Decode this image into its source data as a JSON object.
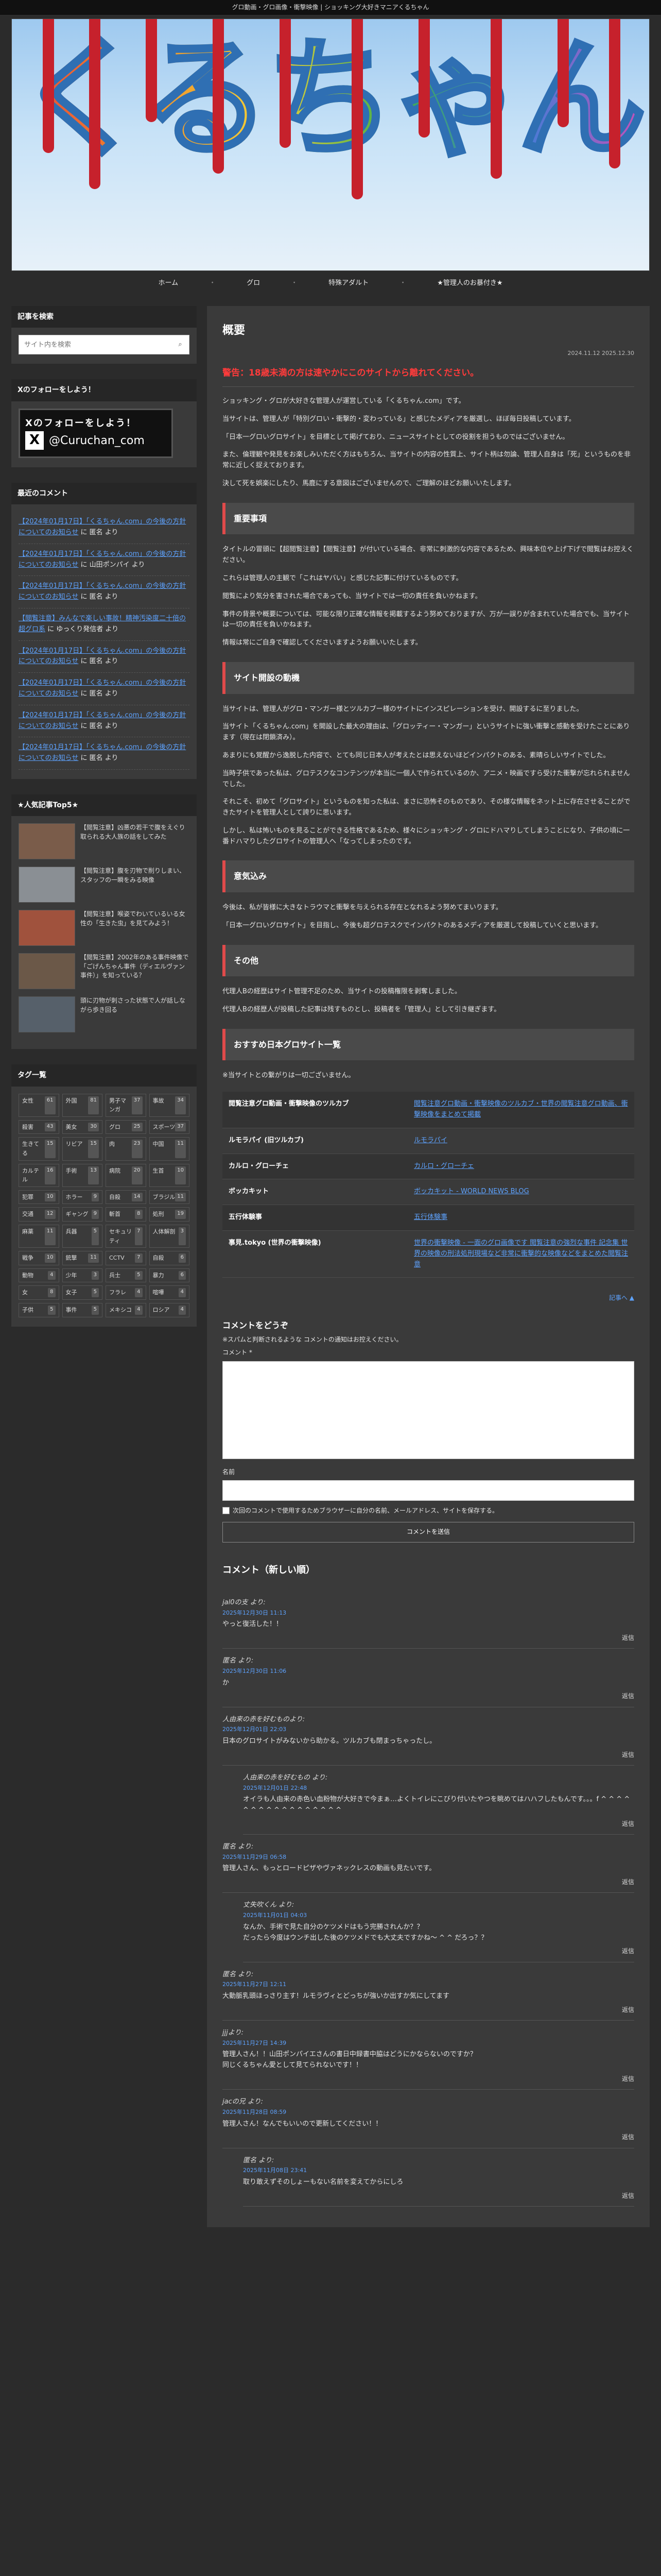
{
  "topbar": "グロ動画・グロ画像・衝撃映像 | ショッキング大好きマニアくるちゃん",
  "banner": {
    "logo_text": "くるちゃん"
  },
  "nav": [
    "ホーム",
    "グロ",
    "特殊アダルト",
    "★管理人のお暴付き★"
  ],
  "sidebar": {
    "search_title": "記事を検索",
    "search_placeholder": "サイト内を検索",
    "follow_title": "Xのフォローをしよう！",
    "x_badge": {
      "line1": "Xのフォローをしよう！",
      "handle": "@Curuchan_com"
    },
    "recent_title": "最近のコメント",
    "recent_comments": [
      {
        "link": "【2024年01月17日】「くるちゃん.com」の今後の方針についてのお知らせ",
        "by": "に 匿名 より"
      },
      {
        "link": "【2024年01月17日】「くるちゃん.com」の今後の方針についてのお知らせ",
        "by": "に 山田ポンパイ より"
      },
      {
        "link": "【2024年01月17日】「くるちゃん.com」の今後の方針についてのお知らせ",
        "by": "に 匿名 より"
      },
      {
        "link": "【閲覧注意】みんなで楽しい事故！精神汚染度二十倍の超グロ系",
        "by": "に ゆっくり発信者 より"
      },
      {
        "link": "【2024年01月17日】「くるちゃん.com」の今後の方針についてのお知らせ",
        "by": "に 匿名 より"
      },
      {
        "link": "【2024年01月17日】「くるちゃん.com」の今後の方針についてのお知らせ",
        "by": "に 匿名 より"
      },
      {
        "link": "【2024年01月17日】「くるちゃん.com」の今後の方針についてのお知らせ",
        "by": "に 匿名 より"
      },
      {
        "link": "【2024年01月17日】「くるちゃん.com」の今後の方針についてのお知らせ",
        "by": "に 匿名 より"
      }
    ],
    "popular_title": "★人気記事Top5★",
    "popular": [
      {
        "text": "【閲覧注意】凶悪の若干で腹をえぐり取られる大人族の話をしてみた",
        "color": "#7a5c4a"
      },
      {
        "text": "【閲覧注意】腹を刃物で削りしまい、スタッフの一瞬をみる映像",
        "color": "#8a8f94"
      },
      {
        "text": "【閲覧注意】喉姿でわいているいる女性の「生きた虫」を見てみよう！",
        "color": "#a0523d"
      },
      {
        "text": "【閲覧注意】2002年のある事件映像で「ごげんちゃん事件（ディエルヴァン事件）」を知っている？",
        "color": "#6b5848"
      },
      {
        "text": "頭に刃物が刺さった状態で人が話しながら歩き回る",
        "color": "#56606a"
      }
    ],
    "tags_title": "タグ一覧",
    "tags": [
      [
        "女性",
        "61"
      ],
      [
        "外国",
        "81"
      ],
      [
        "男子マンガ",
        "37"
      ],
      [
        "事故",
        "34"
      ],
      [
        "殺害",
        "43"
      ],
      [
        "美女",
        "30"
      ],
      [
        "グロ",
        "25"
      ],
      [
        "スポーツ",
        "37"
      ],
      [
        "生きてる",
        "15"
      ],
      [
        "リビア",
        "15"
      ],
      [
        "肉",
        "23"
      ],
      [
        "中国",
        "11"
      ],
      [
        "カルテル",
        "16"
      ],
      [
        "手術",
        "13"
      ],
      [
        "病院",
        "20"
      ],
      [
        "生首",
        "10"
      ],
      [
        "犯罪",
        "10"
      ],
      [
        "ホラー",
        "9"
      ],
      [
        "自殺",
        "14"
      ],
      [
        "ブラジル",
        "11"
      ],
      [
        "交通",
        "12"
      ],
      [
        "ギャング",
        "9"
      ],
      [
        "斬首",
        "8"
      ],
      [
        "処刑",
        "19"
      ],
      [
        "麻薬",
        "11"
      ],
      [
        "兵器",
        "5"
      ],
      [
        "セキュリティ",
        "7"
      ],
      [
        "人体解剖",
        "3"
      ],
      [
        "戦争",
        "10"
      ],
      [
        "銃撃",
        "11"
      ],
      [
        "CCTV",
        "7"
      ],
      [
        "自殺",
        "6"
      ],
      [
        "動物",
        "4"
      ],
      [
        "少年",
        "3"
      ],
      [
        "兵士",
        "5"
      ],
      [
        "暴力",
        "6"
      ],
      [
        "女",
        "8"
      ],
      [
        "女子",
        "5"
      ],
      [
        "フラレ",
        "4"
      ],
      [
        "喧嘩",
        "4"
      ],
      [
        "子供",
        "5"
      ],
      [
        "事件",
        "5"
      ],
      [
        "メキシコ",
        "4"
      ],
      [
        "ロシア",
        "4"
      ]
    ]
  },
  "main": {
    "title": "概要",
    "date": "2024.11.12  2025.12.30",
    "warning": "警告：18歳未満の方は速やかにこのサイトから離れてください。",
    "intro": [
      "ショッキング・グロが大好きな管理人が運営している「くるちゃん.com」です。",
      "当サイトは、管理人が「特別グロい・衝撃的・変わっている」と感じたメディアを厳選し、ほぼ毎日投稿しています。",
      "「日本一グロいグロサイト」を目標として掲げており、ニュースサイトとしての役割を担うものではございません。",
      "また、倫理観や発見をお楽しみいただく方はもちろん、当サイトの内容の性質上、サイト柄は勿論、管理人自身は「死」というものを非常に近しく捉えております。",
      "決して死を娯楽にしたり、馬鹿にする意図はございませんので、ご理解のほどお願いいたします。"
    ],
    "sections": [
      {
        "heading": "重要事項",
        "paragraphs": [
          "タイトルの冒頭に【超閲覧注意】【閲覧注意】が付いている場合、非常に刺激的な内容であるため、興味本位や上げ下げで閲覧はお控えください。",
          "これらは管理人の主観で「これはヤバい」と感じた記事に付けているものです。",
          "閲覧により気分を害された場合であっても、当サイトでは一切の責任を負いかねます。",
          "事件の背景や概要については、可能な限り正確な情報を掲載するよう努めておりますが、万が一誤りが含まれていた場合でも、当サイトは一切の責任を負いかねます。",
          "情報は常にご自身で確認してくださいますようお願いいたします。"
        ]
      },
      {
        "heading": "サイト開設の動機",
        "paragraphs": [
          "当サイトは、管理人がグロ・マンガー様とツルカブー様のサイトにインスピレーションを受け、開設するに至りました。",
          "当サイト「くるちゃん.com」を開設した最大の理由は、「グロッティー・マンガー」というサイトに強い衝撃と感動を受けたことにあります（現在は閉鎖済み）。",
          "あまりにも覚醒から逸脱した内容で、とても同じ日本人が考えたとは思えないほどインパクトのある、素晴らしいサイトでした。",
          "当時子供であった私は、グロテスクなコンテンツが本当に一個人で作られているのか、アニメ・映画ですら受けた衝撃が忘れられませんでした。",
          "それこそ、初めて「グロサイト」というものを知った私は、まさに恐怖そのものであり、その様な情報をネット上に存在させることができたサイトを管理人として誇りに思います。",
          "しかし、私は怖いものを見ることができる性格であるため、様々にショッキング・グロにドハマりしてしまうことになり、子供の頃に一番ドハマりしたグロサイトの管理人へ「なってしまったのです。"
        ]
      },
      {
        "heading": "意気込み",
        "paragraphs": [
          "今後は、私が皆様に大きなトラウマと衝撃を与えられる存在となれるよう努めてまいります。",
          "「日本一グロいグロサイト」を目指し、今後も超グロテスクでインパクトのあるメディアを厳選して投稿していくと思います。"
        ]
      },
      {
        "heading": "その他",
        "paragraphs": [
          "代理人Bの経歴はサイト管理不足のため、当サイトの投稿権限を剥奪しました。",
          "代理人Bの経歴人が投稿した記事は残すものとし、投稿者を「管理人」として引き継ぎます。"
        ]
      },
      {
        "heading": "おすすめ日本グロサイト一覧",
        "paragraphs": [
          "※当サイトとの繋がりは一切ございません。"
        ]
      }
    ],
    "site_table": [
      {
        "name": "閲覧注意グロ動画・衝撃映像のツルカブ",
        "url": "閲覧注意グロ動画・衝撃映像のツルカブ・世界の閲覧注意グロ動画、衝撃映像をまとめて掲載"
      },
      {
        "name": "ルモラパイ (旧ツルカブ)",
        "url": "ルモラパイ"
      },
      {
        "name": "カルロ・グローチェ",
        "url": "カルロ・グローチェ"
      },
      {
        "name": "ボッカキット",
        "url": "ボッカキット - WORLD NEWS BLOG"
      },
      {
        "name": "五行体験事",
        "url": "五行体験事"
      },
      {
        "name": "事見.tokyo (世界の衝撃映像)",
        "url": "世界の衝撃映像 - 一面のグロ画像です 閲覧注意の強烈な事件 記念集 世界の映像の刑法処刑現場など非常に衝撃的な映像などをまとめた閲覧注意"
      }
    ],
    "back_to_top": "記事へ ▲",
    "form": {
      "title": "コメントをどうぞ",
      "note": "※スパムと判断されるような コメントの通知はお控えください。",
      "comment_label": "コメント *",
      "name_label": "名前",
      "checkbox": "次回のコメントで使用するためブラウザーに自分の名前、メールアドレス、サイトを保存する。",
      "submit": "コメントを送信"
    },
    "comments_title": "コメント（新しい順）",
    "comments": [
      {
        "who": "jal0の支 より:",
        "when": "2025年12月30日 11:13",
        "body": "やっと復活した！！",
        "nested": false
      },
      {
        "who": "匿名 より:",
        "when": "2025年12月30日 11:06",
        "body": "か",
        "nested": false
      },
      {
        "who": "人由来の赤を好むものより:",
        "when": "2025年12月01日 22:03",
        "body": "日本のグロサイトがみないから助かる。ツルカブも閉まっちゃったし。",
        "nested": false
      },
      {
        "who": "人由来の赤を好むもの より:",
        "when": "2025年12月01日 22:48",
        "body": "オイラも人由来の赤色い血粉物が大好きで今まぁ…よくトイレにこびり付いたやつを眺めてはハハフしたもんです。。。f ^ ^ ^ ^ ^ ^ ^ ^ ^ ^ ^ ^ ^ ^ ^ ^ ^",
        "nested": true
      },
      {
        "who": "匿名 より:",
        "when": "2025年11月29日 06:58",
        "body": "管理人さん、もっとロードピザやヴァネックレスの動画も見たいです。",
        "nested": false
      },
      {
        "who": "丈失吹くん より:",
        "when": "2025年11月01日 04:03",
        "body": "なんか、手術で見た自分のケツメドはもう完勝されんか？？\nだったら今度はウンチ出した後のケツメドでも大丈夫ですかね～ ^ ^ だろっ？？",
        "nested": true
      },
      {
        "who": "匿名 より:",
        "when": "2025年11月27日 12:11",
        "body": "大動脈乳頭ほっさり主す！ルモラヴィとどっちが強いか出すか気にしてます",
        "nested": false
      },
      {
        "who": "jjjより:",
        "when": "2025年11月27日 14:39",
        "body": "管理人さん！！山田ポンパイエさんの書日中録書中脇はどうにかならないのですか？\n同じくるちゃん愛として見てられないです！！",
        "nested": false
      },
      {
        "who": "jacの兄 より:",
        "when": "2025年11月28日 08:59",
        "body": "管理人さん！なんでもいいので更新してください！！",
        "nested": false
      },
      {
        "who": "匿名 より:",
        "when": "2025年11月08日 23:41",
        "body": "取り敢えずそのしょーもない名前を変えてからにしろ",
        "nested": true
      }
    ],
    "reply_label": "返信"
  }
}
